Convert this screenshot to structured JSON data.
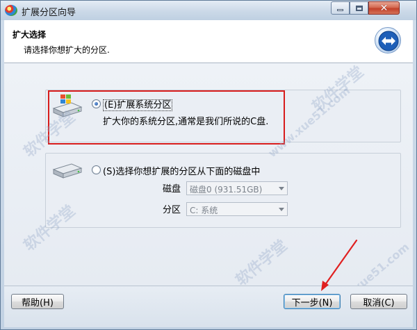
{
  "window": {
    "title": "扩展分区向导",
    "close_glyph": "✕"
  },
  "header": {
    "title": "扩大选择",
    "subtitle": "请选择你想扩大的分区."
  },
  "options": [
    {
      "accel": "(E)",
      "label": "扩展系统分区",
      "description": "扩大你的系统分区,通常是我们所说的C盘.",
      "selected": true
    },
    {
      "label": "(S)选择你想扩展的分区从下面的磁盘中",
      "selected": false
    }
  ],
  "disk_field": {
    "label": "磁盘",
    "value": "磁盘0 (931.51GB)"
  },
  "partition_field": {
    "label": "分区",
    "value": "C: 系统"
  },
  "buttons": {
    "help": "帮助(H)",
    "next": "下一步(N)",
    "cancel": "取消(C)"
  },
  "watermark": {
    "text_cn": "软件学堂",
    "text_url": "www.xue51.com"
  },
  "colors": {
    "highlight_border": "#d81c1c",
    "annotation_arrow": "#e02020"
  },
  "icons": [
    "app-icon",
    "minimize-icon",
    "maximize-icon",
    "close-icon",
    "wizard-arrows-icon",
    "windows-drive-icon",
    "hard-drive-icon",
    "chevron-down-icon"
  ]
}
